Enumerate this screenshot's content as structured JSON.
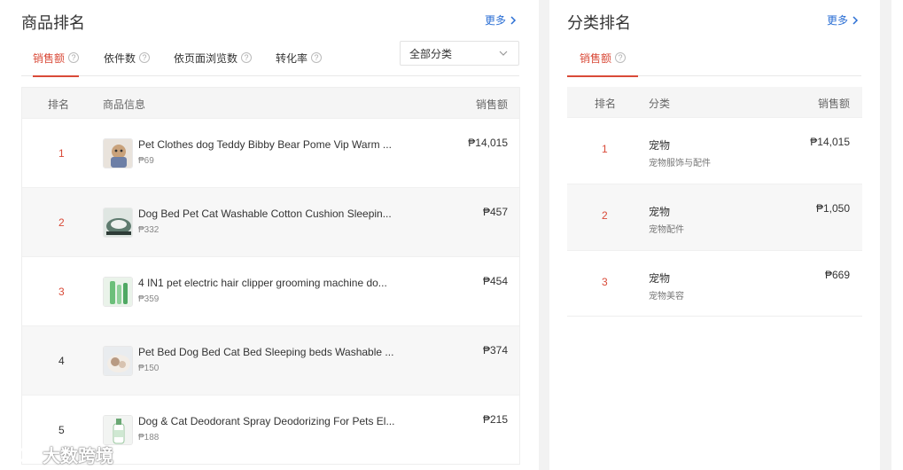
{
  "left": {
    "title": "商品排名",
    "more": "更多",
    "tabs": [
      "销售额",
      "依件数",
      "依页面浏览数",
      "转化率"
    ],
    "category_select": "全部分类",
    "columns": {
      "rank": "排名",
      "info": "商品信息",
      "sales": "销售额"
    },
    "rows": [
      {
        "rank": "1",
        "name": "Pet Clothes dog Teddy Bibby Bear Pome Vip Warm ...",
        "price": "₱69",
        "sales": "₱14,015"
      },
      {
        "rank": "2",
        "name": "Dog Bed Pet Cat Washable Cotton Cushion Sleepin...",
        "price": "₱332",
        "sales": "₱457"
      },
      {
        "rank": "3",
        "name": "4 IN1 pet electric hair clipper grooming machine do...",
        "price": "₱359",
        "sales": "₱454"
      },
      {
        "rank": "4",
        "name": "Pet Bed Dog Bed Cat Bed Sleeping beds Washable ...",
        "price": "₱150",
        "sales": "₱374"
      },
      {
        "rank": "5",
        "name": "Dog & Cat Deodorant Spray Deodorizing For Pets El...",
        "price": "₱188",
        "sales": "₱215"
      }
    ]
  },
  "right": {
    "title": "分类排名",
    "more": "更多",
    "tab": "销售额",
    "columns": {
      "rank": "排名",
      "category": "分类",
      "sales": "销售额"
    },
    "rows": [
      {
        "rank": "1",
        "category": "宠物",
        "sub": "宠物服饰与配件",
        "sales": "₱14,015"
      },
      {
        "rank": "2",
        "category": "宠物",
        "sub": "宠物配件",
        "sales": "₱1,050"
      },
      {
        "rank": "3",
        "category": "宠物",
        "sub": "宠物美容",
        "sales": "₱669"
      }
    ]
  },
  "watermark": "大数跨境",
  "colors": {
    "accent": "#d94a38",
    "link": "#2a6ed4"
  }
}
